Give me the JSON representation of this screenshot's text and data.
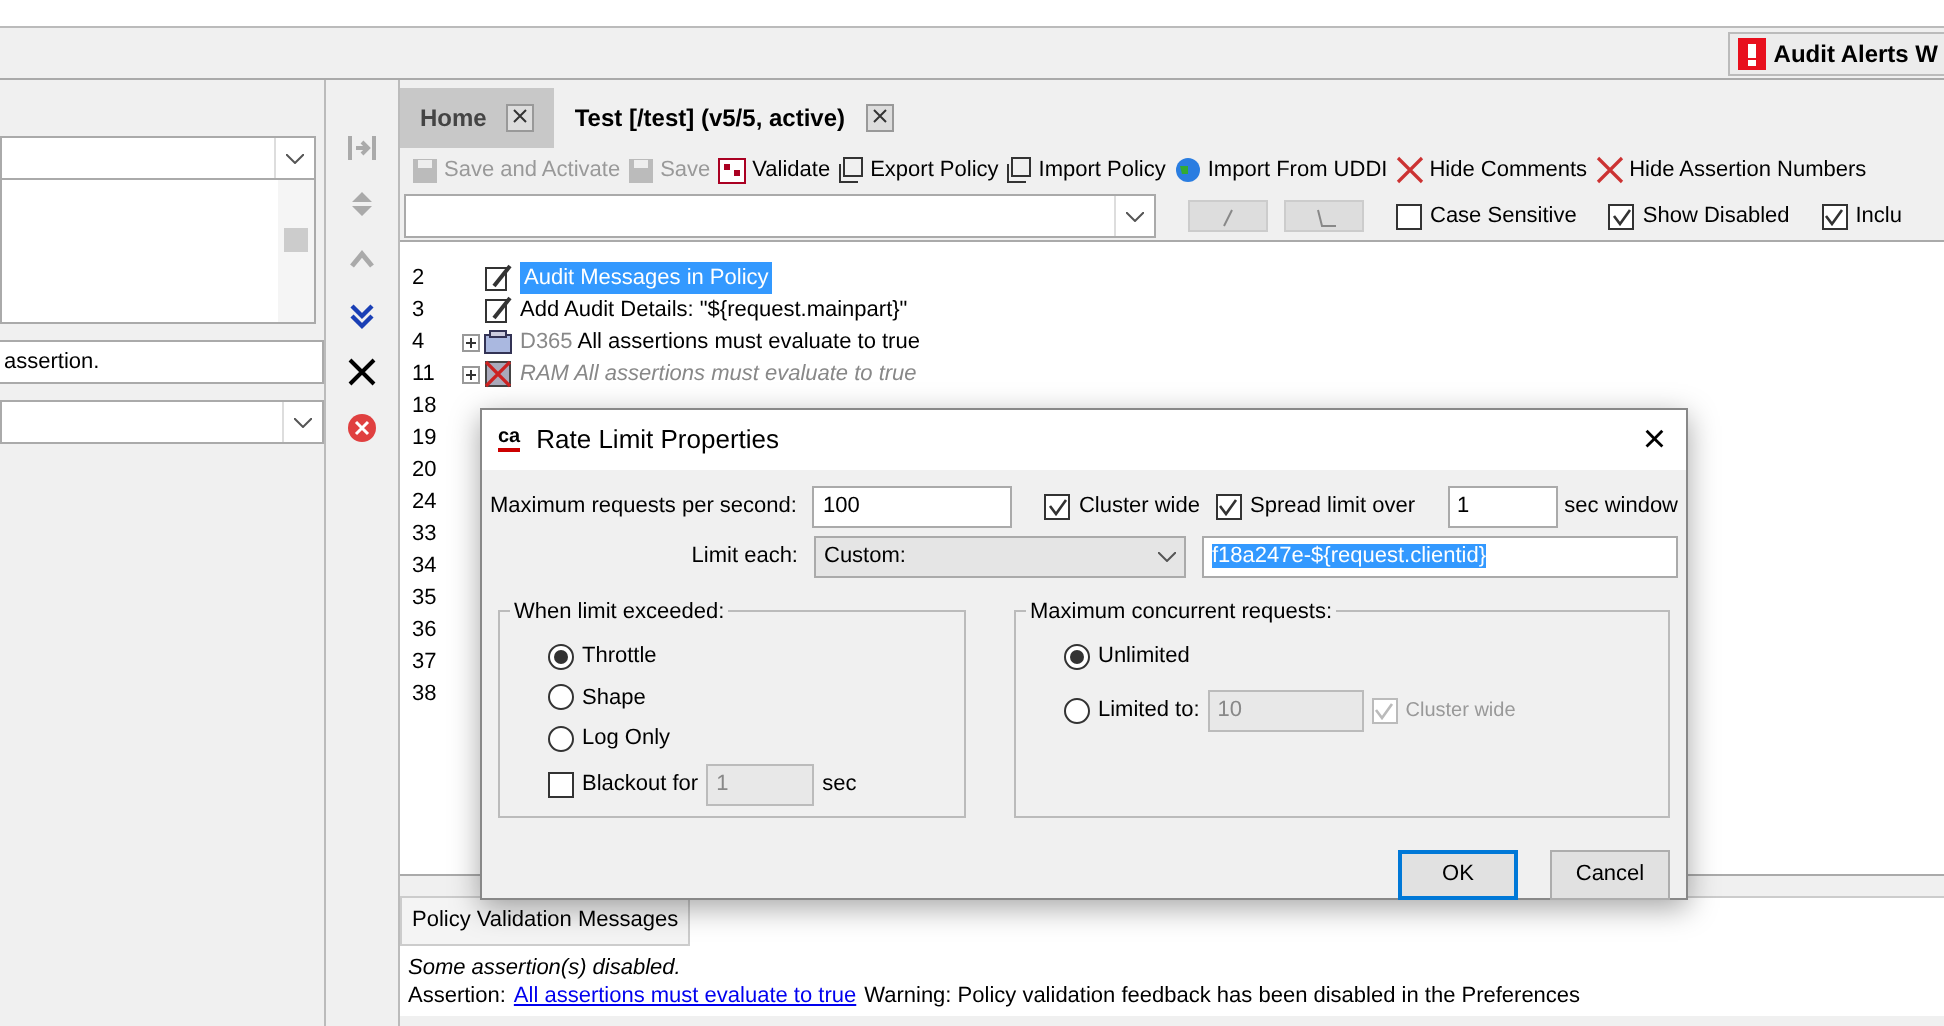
{
  "alerts_button": {
    "label": "Audit Alerts W"
  },
  "left_panel": {
    "text": "assertion."
  },
  "side_toolbar": [
    {
      "kind": "collapse",
      "disabled": true
    },
    {
      "kind": "diamond",
      "disabled": true
    },
    {
      "kind": "up",
      "disabled": true
    },
    {
      "kind": "down",
      "disabled": false
    },
    {
      "kind": "delete",
      "disabled": false
    },
    {
      "kind": "stop",
      "disabled": false
    }
  ],
  "tabs": [
    {
      "label": "Home",
      "selected": false
    },
    {
      "label": "Test [/test] (v5/5, active)",
      "selected": true
    }
  ],
  "toolbar": [
    {
      "kind": "save",
      "label": "Save and Activate",
      "disabled": true
    },
    {
      "kind": "save",
      "label": "Save",
      "disabled": true
    },
    {
      "kind": "validate",
      "label": "Validate",
      "disabled": false
    },
    {
      "kind": "export",
      "label": "Export Policy",
      "disabled": false
    },
    {
      "kind": "export",
      "label": "Import Policy",
      "disabled": false
    },
    {
      "kind": "globe",
      "label": "Import From UDDI",
      "disabled": false
    },
    {
      "kind": "hide",
      "label": "Hide Comments",
      "disabled": false
    },
    {
      "kind": "hide",
      "label": "Hide Assertion Numbers",
      "disabled": false
    }
  ],
  "search_options": [
    {
      "label": "Case Sensitive",
      "checked": false
    },
    {
      "label": "Show Disabled",
      "checked": true
    },
    {
      "label": "Inclu",
      "checked": true
    }
  ],
  "tree": [
    {
      "number": "2",
      "kind": "audit",
      "text": "Audit Messages in Policy",
      "selected": true,
      "disabled": false,
      "expandable": false
    },
    {
      "number": "3",
      "kind": "audit",
      "text": "Add Audit Details: \"${request.mainpart}\"",
      "selected": false,
      "disabled": false,
      "expandable": false
    },
    {
      "number": "4",
      "kind": "folder",
      "prefix": "D365",
      "text": "All assertions must evaluate to true",
      "selected": false,
      "disabled": false,
      "expandable": true
    },
    {
      "number": "11",
      "kind": "crossed",
      "text": "RAM All assertions must evaluate to true",
      "selected": false,
      "disabled": true,
      "expandable": true
    },
    {
      "number": "18"
    },
    {
      "number": "19"
    },
    {
      "number": "20"
    },
    {
      "number": "24"
    },
    {
      "number": "33"
    },
    {
      "number": "34"
    },
    {
      "number": "35"
    },
    {
      "number": "36"
    },
    {
      "number": "37"
    },
    {
      "number": "38"
    }
  ],
  "messages": {
    "tab": "Policy Validation Messages",
    "line_1": "Some assertion(s) disabled.",
    "prefix": "Assertion:",
    "link": "All assertions must evaluate to true",
    "warning": "Warning: Policy validation feedback has been disabled in the Preferences"
  },
  "dialog": {
    "logo": "ca",
    "title": "Rate Limit Properties",
    "close": "×",
    "max_requests_label": "Maximum requests per second:",
    "max_requests": "100",
    "cluster_wide": {
      "label": "Cluster wide",
      "checked": true
    },
    "spread": {
      "label": "Spread limit over",
      "checked": true
    },
    "spread_value": "1",
    "spread_unit": "sec window",
    "limit_each_label": "Limit each:",
    "limit_each": "Custom:",
    "custom_value": "f18a247e-${request.clientid}",
    "exceeded": {
      "title": "When limit exceeded:",
      "options": [
        {
          "label": "Throttle",
          "selected": true
        },
        {
          "label": "Shape",
          "selected": false
        },
        {
          "label": "Log Only",
          "selected": false
        }
      ],
      "blackout": {
        "label": "Blackout for",
        "checked": false
      },
      "blackout_value": "1",
      "blackout_unit": "sec"
    },
    "concurrent": {
      "title": "Maximum concurrent requests:",
      "options": [
        {
          "label": "Unlimited",
          "selected": true
        },
        {
          "label": "Limited to:",
          "selected": false
        }
      ],
      "limit_value": "10",
      "cluster_wide": {
        "label": "Cluster wide",
        "checked": true,
        "disabled": true
      }
    },
    "buttons": [
      "OK",
      "Cancel"
    ]
  }
}
